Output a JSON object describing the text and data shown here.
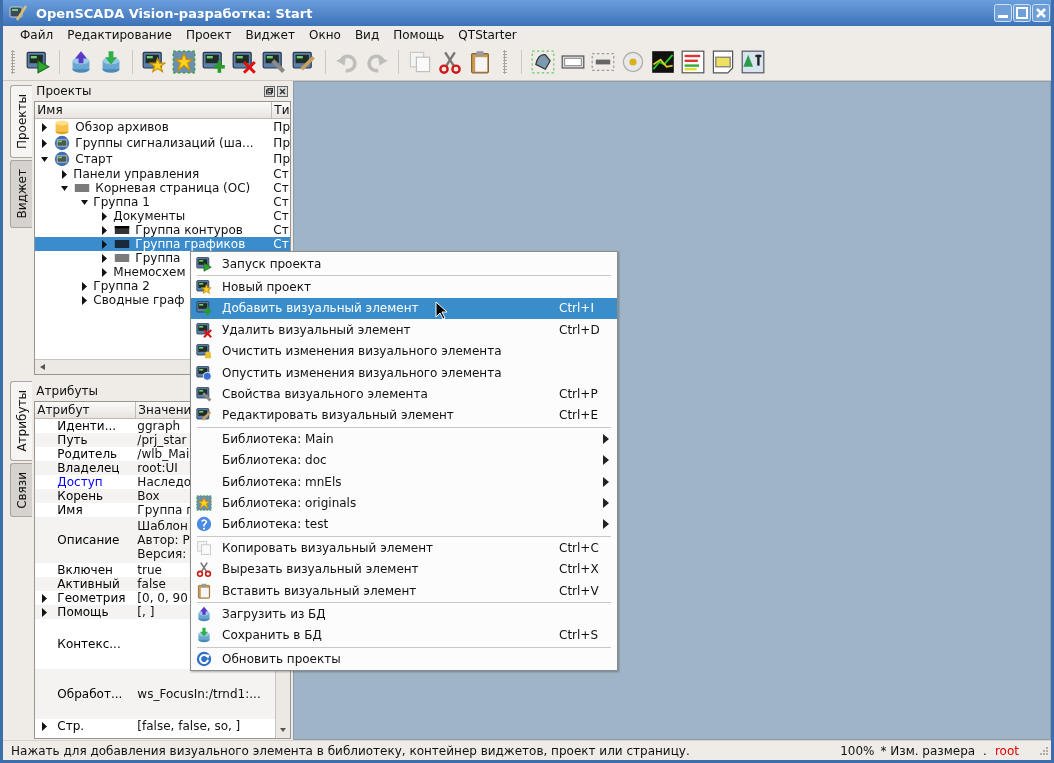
{
  "window": {
    "title": "OpenSCADA Vision-разработка: Start"
  },
  "menubar": [
    "Файл",
    "Редактирование",
    "Проект",
    "Виджет",
    "Окно",
    "Вид",
    "Помощь",
    "QTStarter"
  ],
  "toolbar": {
    "groups": [
      [
        {
          "disabled": false
        }
      ],
      [
        {
          "disabled": false
        },
        {
          "disabled": false
        }
      ],
      [
        {
          "disabled": false
        },
        {
          "disabled": false
        },
        {
          "disabled": false
        },
        {
          "disabled": false
        },
        {
          "disabled": false
        },
        {
          "disabled": false
        }
      ],
      [
        {
          "disabled": true
        },
        {
          "disabled": true
        }
      ],
      [
        {
          "disabled": false
        },
        {
          "disabled": false
        },
        {
          "disabled": false
        }
      ],
      [
        {
          "disabled": false
        },
        {
          "disabled": false
        },
        {
          "disabled": false
        },
        {
          "disabled": false
        },
        {
          "disabled": false
        },
        {
          "disabled": false
        },
        {
          "disabled": false
        },
        {
          "disabled": false
        }
      ]
    ]
  },
  "dock_tabs_top": [
    {
      "label": "Проекты",
      "selected": true
    },
    {
      "label": "Виджет",
      "selected": false
    }
  ],
  "projects": {
    "title": "Проекты",
    "columns": [
      "Имя",
      "Ти"
    ],
    "items": [
      {
        "name": "Обзор архивов",
        "type": "Пр",
        "expanded": false,
        "selected": false
      },
      {
        "name": "Группы сигнализаций (ша...",
        "type": "Пр",
        "expanded": false,
        "selected": false
      },
      {
        "name": "Старт",
        "type": "Пр",
        "expanded": true,
        "selected": false,
        "children": [
          {
            "name": "Панели управления",
            "type": "Ст",
            "expanded": false,
            "selected": false
          },
          {
            "name": "Корневая страница (ОС)",
            "type": "Ст",
            "expanded": true,
            "selected": false,
            "children": [
              {
                "name": "Группа 1",
                "type": "Ст",
                "expanded": true,
                "selected": false,
                "children": [
                  {
                    "name": "Документы",
                    "type": "Ст",
                    "expanded": false,
                    "selected": false
                  },
                  {
                    "name": "Группа контуров",
                    "type": "Ст",
                    "expanded": false,
                    "selected": false
                  },
                  {
                    "name": "Группа графиков",
                    "type": "Ст",
                    "expanded": false,
                    "selected": true
                  },
                  {
                    "name": "Группа",
                    "expanded": false,
                    "selected": false
                  },
                  {
                    "name": "Мнемосхем",
                    "expanded": false,
                    "selected": false
                  }
                ]
              },
              {
                "name": "Группа 2",
                "expanded": false,
                "selected": false
              },
              {
                "name": "Сводные граф",
                "expanded": false,
                "selected": false
              }
            ]
          }
        ]
      }
    ]
  },
  "dock_tabs_bottom": [
    {
      "label": "Атрибуты",
      "selected": true
    },
    {
      "label": "Связи",
      "selected": false
    }
  ],
  "attributes": {
    "title": "Атрибуты",
    "columns": [
      "Атрибут",
      "Значени"
    ],
    "rows": [
      {
        "name": "Иденти...",
        "value": [
          "ggraph"
        ],
        "kind": "text",
        "expandable": false,
        "color": "#000000"
      },
      {
        "name": "Путь",
        "value": [
          "/prj_star"
        ],
        "kind": "text",
        "expandable": false,
        "color": "#000000"
      },
      {
        "name": "Родитель",
        "value": [
          "/wlb_Mai"
        ],
        "kind": "text",
        "expandable": false,
        "color": "#000000"
      },
      {
        "name": "Владелец",
        "value": [
          "root:UI"
        ],
        "kind": "text",
        "expandable": false,
        "color": "#000000"
      },
      {
        "name": "Доступ",
        "value": [
          "Наследо"
        ],
        "kind": "text",
        "expandable": false,
        "color": "#0000ff"
      },
      {
        "name": "Корень",
        "value": [
          "Box"
        ],
        "kind": "text",
        "expandable": false,
        "color": "#000000"
      },
      {
        "name": "Имя",
        "value": [
          "Группа г"
        ],
        "kind": "text",
        "expandable": false,
        "color": "#000000"
      },
      {
        "name": "Описание",
        "value": [
          "Шаблон",
          "Автор: Р",
          "Версия:"
        ],
        "kind": "text",
        "expandable": false,
        "color": "#000000"
      },
      {
        "name": "Включен",
        "value": [
          "true"
        ],
        "kind": "text",
        "expandable": false,
        "color": "#000000"
      },
      {
        "name": "Активный",
        "value": [
          "false"
        ],
        "kind": "text",
        "expandable": false,
        "color": "#000000"
      },
      {
        "name": "Геометрия",
        "value": [
          "[0, 0, 90"
        ],
        "kind": "text",
        "expandable": true,
        "color": "#000000"
      },
      {
        "name": "Помощь",
        "value": [
          "[, ]"
        ],
        "kind": "text",
        "expandable": true,
        "color": "#000000"
      },
      {
        "name": "Контекс...",
        "kind": "multiline",
        "expandable": false,
        "color": "#000000"
      },
      {
        "name": "Обработ...",
        "value": [
          "ws_FocusIn:/trnd1:..."
        ],
        "kind": "multiline",
        "expandable": false,
        "color": "#000000"
      },
      {
        "name": "Стр.",
        "value": [
          "[false, false, so, ]"
        ],
        "kind": "text",
        "expandable": true,
        "color": "#000000"
      }
    ]
  },
  "context_menu": {
    "sections": [
      [
        {
          "label": "Запуск проекта",
          "submenu": false,
          "selected": false
        }
      ],
      [
        {
          "label": "Новый проект",
          "submenu": false,
          "selected": false
        },
        {
          "label": "Добавить визуальный элемент",
          "shortcut": "Ctrl+I",
          "submenu": false,
          "selected": true
        },
        {
          "label": "Удалить визуальный элемент",
          "shortcut": "Ctrl+D",
          "submenu": false,
          "selected": false
        },
        {
          "label": "Очистить изменения визуального элемента",
          "submenu": false,
          "selected": false
        },
        {
          "label": "Опустить изменения визуального элемента",
          "submenu": false,
          "selected": false
        },
        {
          "label": "Свойства визуального элемента",
          "shortcut": "Ctrl+P",
          "submenu": false,
          "selected": false
        },
        {
          "label": "Редактировать визуальный элемент",
          "shortcut": "Ctrl+E",
          "submenu": false,
          "selected": false
        }
      ],
      [
        {
          "label": "Библиотека: Main",
          "submenu": true,
          "selected": false
        },
        {
          "label": "Библиотека: doc",
          "submenu": true,
          "selected": false
        },
        {
          "label": "Библиотека: mnEls",
          "submenu": true,
          "selected": false
        },
        {
          "label": "Библиотека: originals",
          "submenu": true,
          "selected": false
        },
        {
          "label": "Библиотека: test",
          "submenu": true,
          "selected": false
        }
      ],
      [
        {
          "label": "Копировать визуальный элемент",
          "shortcut": "Ctrl+C",
          "submenu": false,
          "selected": false
        },
        {
          "label": "Вырезать визуальный элемент",
          "shortcut": "Ctrl+X",
          "submenu": false,
          "selected": false
        },
        {
          "label": "Вставить визуальный элемент",
          "shortcut": "Ctrl+V",
          "submenu": false,
          "selected": false
        }
      ],
      [
        {
          "label": "Загрузить из БД",
          "submenu": false,
          "selected": false
        },
        {
          "label": "Сохранить в БД",
          "shortcut": "Ctrl+S",
          "submenu": false,
          "selected": false
        }
      ],
      [
        {
          "label": "Обновить проекты",
          "submenu": false,
          "selected": false
        }
      ]
    ]
  },
  "status_bar": {
    "message": "Нажать для добавления визуального элемента в библиотеку, контейнер виджетов, проект или страницу.",
    "zoom": "100%",
    "mode": "* Изм. размера",
    "separator": ".",
    "user": "root"
  }
}
